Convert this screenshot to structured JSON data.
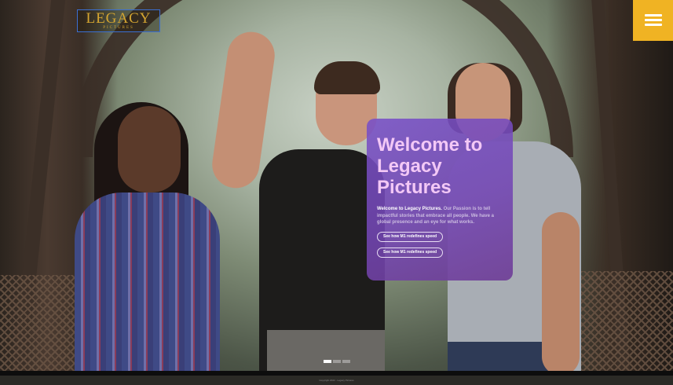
{
  "logo": {
    "main": "LEGACY",
    "sub": "PICTURES"
  },
  "menu": {
    "icon": "hamburger-menu-icon",
    "color": "#f0b323"
  },
  "card": {
    "title": "Welcome to Legacy Pictures",
    "intro_bold": "Welcome to Legacy Pictures.",
    "intro_text": " Our Passion is to tell impactful stories that embrace all people. We have a global presence and an eye for what works.",
    "button1": "See how M1 redefines speed",
    "button2": "See how M1 redefines speed"
  },
  "slider": {
    "count": 3,
    "active": 0
  },
  "footer": {
    "text": "Copyright 2022 - Legacy Pictures"
  }
}
